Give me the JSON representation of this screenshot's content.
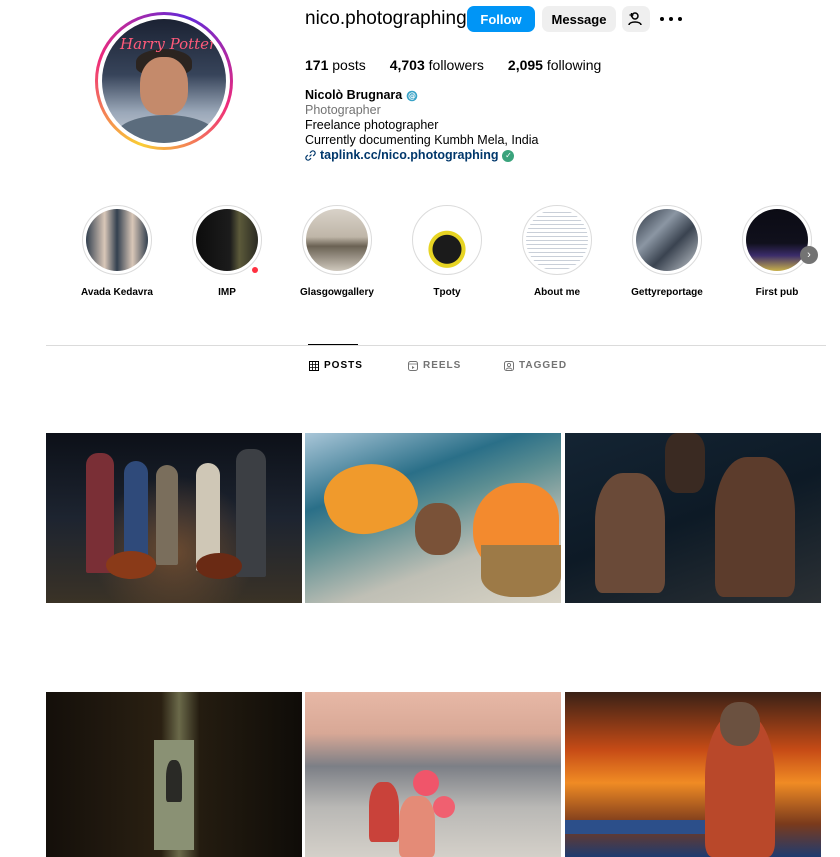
{
  "profile": {
    "username": "nico.photographing",
    "avatar_overlay_text": "Harry Potter",
    "follow_label": "Follow",
    "message_label": "Message",
    "add_user_icon": "add-user-icon",
    "more_icon": "more-options-icon"
  },
  "stats": {
    "posts_count": "171",
    "posts_label": "posts",
    "followers_count": "4,703",
    "followers_label": "followers",
    "following_count": "2,095",
    "following_label": "following"
  },
  "bio": {
    "full_name": "Nicolò Brugnara",
    "category": "Photographer",
    "line1": "Freelance photographer",
    "line2": "Currently documenting Kumbh Mela, India",
    "link": "taplink.cc/nico.photographing"
  },
  "highlights": [
    {
      "label": "Avada Kedavra"
    },
    {
      "label": "IMP"
    },
    {
      "label": "Glasgowgallery"
    },
    {
      "label": "Tpoty"
    },
    {
      "label": "About me"
    },
    {
      "label": "Gettyreportage"
    },
    {
      "label": "First pub"
    }
  ],
  "tabs": {
    "posts": "POSTS",
    "reels": "REELS",
    "tagged": "TAGGED"
  },
  "colors": {
    "follow_button": "#0095f6",
    "secondary_button": "#efefef",
    "link_text": "#00376b",
    "muted_text": "#737373",
    "notification_dot": "#ff3040"
  }
}
